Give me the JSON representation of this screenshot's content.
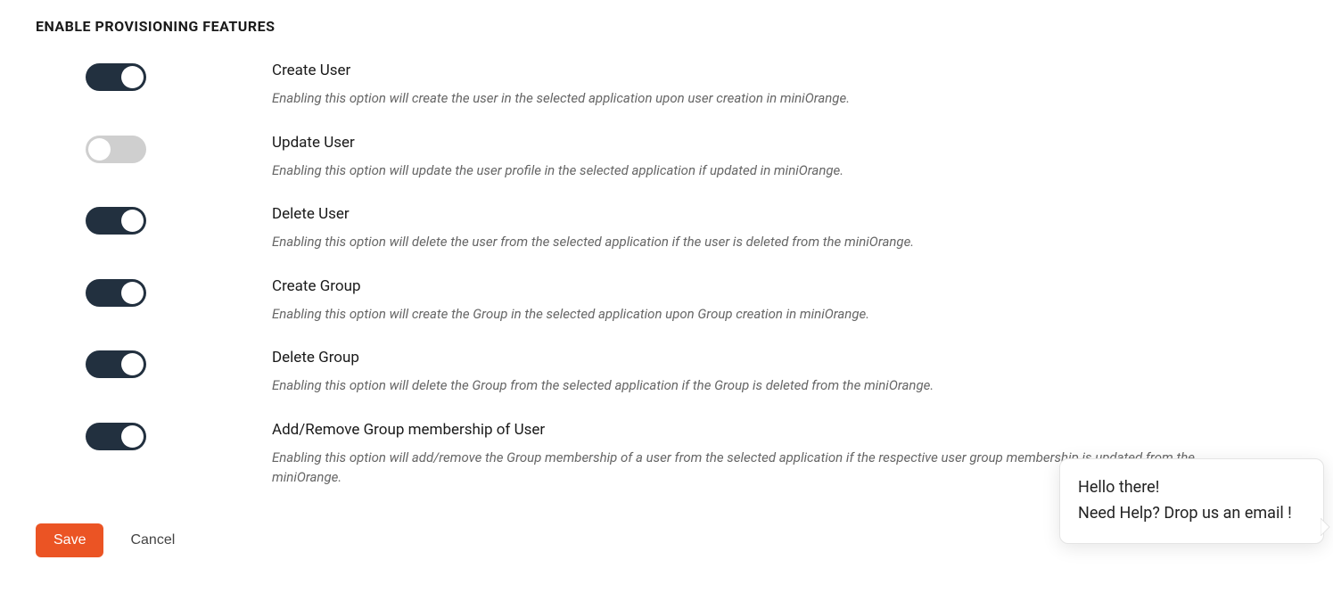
{
  "section": {
    "title": "ENABLE PROVISIONING FEATURES"
  },
  "features": [
    {
      "key": "create-user",
      "enabled": true,
      "title": "Create User",
      "desc": "Enabling this option will create the user in the selected application upon user creation in miniOrange."
    },
    {
      "key": "update-user",
      "enabled": false,
      "title": "Update User",
      "desc": "Enabling this option will update the user profile in the selected application if updated in miniOrange."
    },
    {
      "key": "delete-user",
      "enabled": true,
      "title": "Delete User",
      "desc": "Enabling this option will delete the user from the selected application if the user is deleted from the miniOrange."
    },
    {
      "key": "create-group",
      "enabled": true,
      "title": "Create Group",
      "desc": "Enabling this option will create the Group in the selected application upon Group creation in miniOrange."
    },
    {
      "key": "delete-group",
      "enabled": true,
      "title": "Delete Group",
      "desc": "Enabling this option will delete the Group from the selected application if the Group is deleted from the miniOrange."
    },
    {
      "key": "group-membership",
      "enabled": true,
      "title": "Add/Remove Group membership of User",
      "desc": "Enabling this option will add/remove the Group membership of a user from the selected application if the respective user group membership is updated from the miniOrange."
    }
  ],
  "buttons": {
    "save": "Save",
    "cancel": "Cancel"
  },
  "chat": {
    "line1": "Hello there!",
    "line2": "Need Help? Drop us an email !"
  }
}
